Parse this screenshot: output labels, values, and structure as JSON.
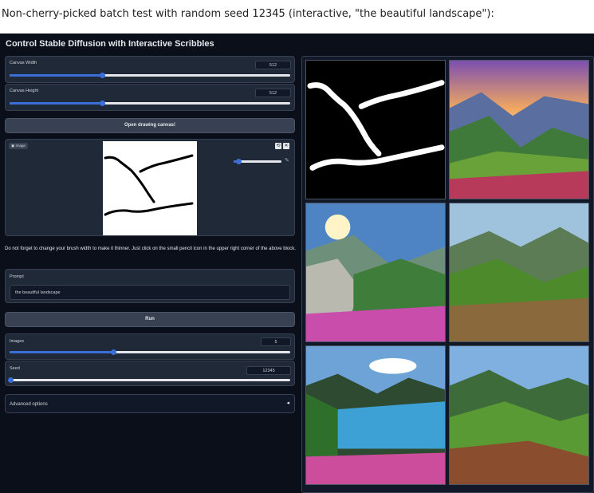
{
  "caption": "Non-cherry-picked batch test with random seed 12345 (interactive, \"the beautiful landscape\"):",
  "app_title": "Control Stable Diffusion with Interactive Scribbles",
  "canvas_width": {
    "label": "Canvas Width",
    "value": "512",
    "fraction": 0.33
  },
  "canvas_height": {
    "label": "Canvas Height",
    "value": "512",
    "fraction": 0.33
  },
  "open_canvas_label": "Open drawing canvas!",
  "image_block": {
    "label": "Image",
    "brush_fraction": 0.1
  },
  "note": "Do not forget to change your brush width to make it thinner. Just click on the small pencil icon in the upper right corner of the above block.",
  "prompt": {
    "label": "Prompt",
    "value": "the beautiful landscape"
  },
  "run_label": "Run",
  "images": {
    "label": "Images",
    "value": "5",
    "fraction": 0.37
  },
  "seed": {
    "label": "Seed",
    "value": "12345",
    "fraction": 0.005
  },
  "advanced_label": "Advanced options",
  "colors": {
    "accent": "#3b6fd8",
    "background": "#0b0f19",
    "panel": "#1f2937"
  },
  "icons": [
    "image-icon",
    "clear-icon",
    "close-icon",
    "pencil-icon",
    "collapse-arrow-icon"
  ]
}
